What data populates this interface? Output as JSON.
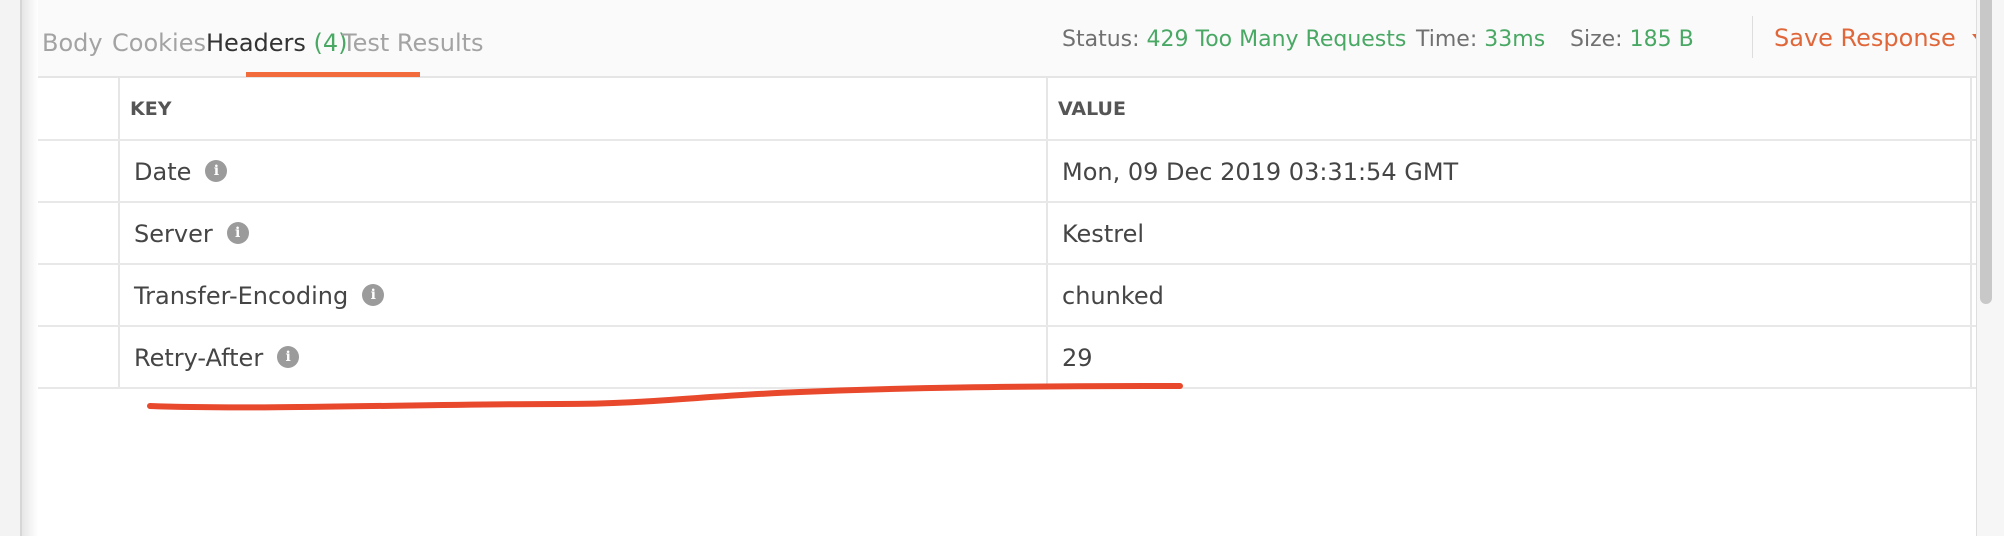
{
  "tabs": [
    {
      "label": "Body"
    },
    {
      "label": "Cookies"
    },
    {
      "label": "Headers",
      "count": "(4)",
      "active": true
    },
    {
      "label": "Test Results"
    }
  ],
  "status": {
    "label": "Status:",
    "value": "429 Too Many Requests"
  },
  "time": {
    "label": "Time:",
    "value": "33ms"
  },
  "size": {
    "label": "Size:",
    "value": "185 B"
  },
  "save_response": {
    "label": "Save Response"
  },
  "table": {
    "columns": {
      "key": "KEY",
      "value": "VALUE"
    },
    "rows": [
      {
        "key": "Date",
        "value": "Mon, 09 Dec 2019 03:31:54 GMT"
      },
      {
        "key": "Server",
        "value": "Kestrel"
      },
      {
        "key": "Transfer-Encoding",
        "value": "chunked"
      },
      {
        "key": "Retry-After",
        "value": "29"
      }
    ]
  },
  "info_icon_glyph": "i",
  "colors": {
    "accent": "#f26b3a",
    "status_green": "#4aa865",
    "annotation_red": "#e8482c"
  }
}
